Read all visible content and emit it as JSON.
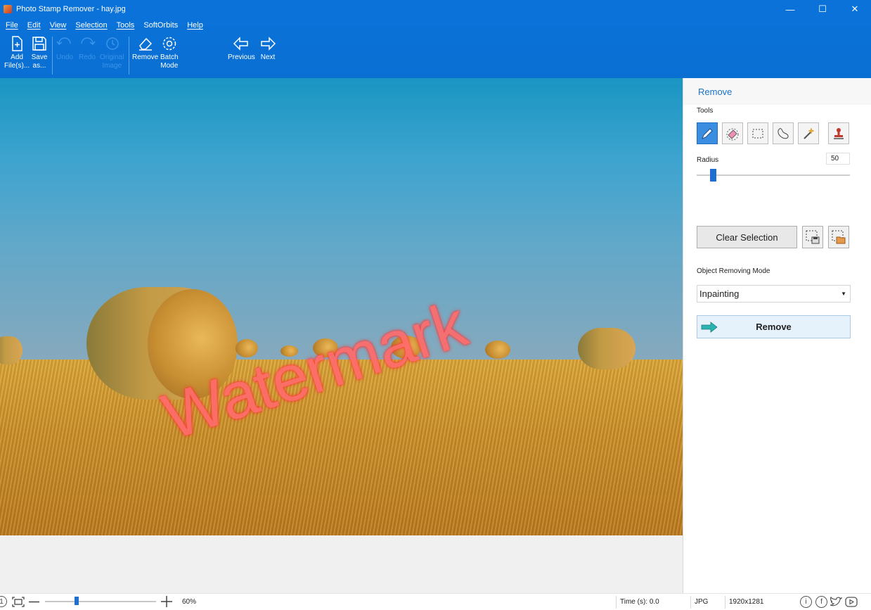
{
  "window": {
    "title": "Photo Stamp Remover - hay.jpg",
    "controls": {
      "minimize": "—",
      "maximize": "☐",
      "close": "✕"
    }
  },
  "menu": [
    "File",
    "Edit",
    "View",
    "Selection",
    "Tools",
    "SoftOrbits",
    "Help"
  ],
  "toolbar": {
    "add_files": {
      "line1": "Add",
      "line2": "File(s)..."
    },
    "save_as": {
      "line1": "Save",
      "line2": "as..."
    },
    "undo": "Undo",
    "redo": "Redo",
    "original_image": {
      "line1": "Original",
      "line2": "Image"
    },
    "remove": "Remove",
    "batch_mode": {
      "line1": "Batch",
      "line2": "Mode"
    },
    "previous": "Previous",
    "next": "Next"
  },
  "canvas": {
    "watermark_text": "Watermark"
  },
  "panel": {
    "header": "Remove",
    "tools_label": "Tools",
    "tools": [
      "pencil-icon",
      "eraser-icon",
      "rect-select-icon",
      "lasso-icon",
      "magic-wand-icon",
      "stamp-icon"
    ],
    "radius_label": "Radius",
    "radius_value": "50",
    "radius_fraction": 0.1,
    "clear_selection": "Clear Selection",
    "mode_label": "Object Removing Mode",
    "mode_value": "Inpainting",
    "remove_button": "Remove"
  },
  "statusbar": {
    "zoom": "60%",
    "time": "Time (s): 0.0",
    "format": "JPG",
    "dimensions": "1920x1281"
  },
  "colors": {
    "accent": "#0a72d8",
    "watermark": "#ff6b6b"
  }
}
